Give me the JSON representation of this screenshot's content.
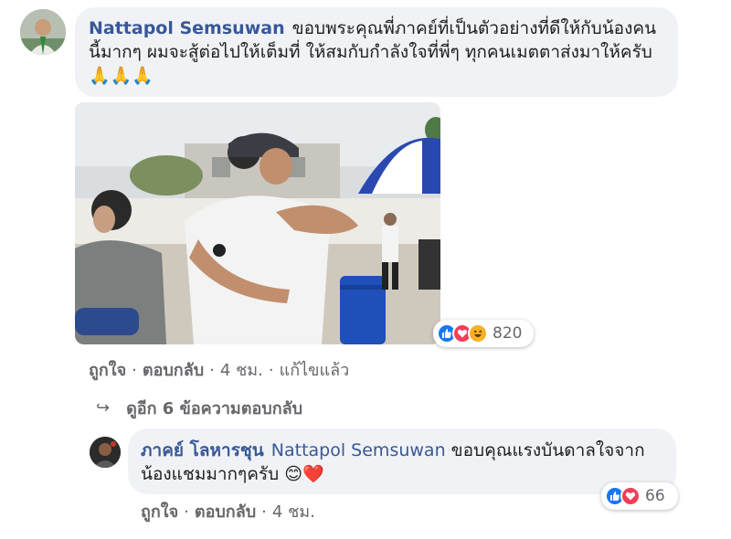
{
  "comment": {
    "author": "Nattapol Semsuwan",
    "text": "ขอบพระคุณพี่ภาคย์ที่เป็นตัวอย่างที่ดีให้กับน้องคนนี้มากๆ ผมจะสู้ต่อไปให้เต็มที่ ให้สมกับกำลังใจที่พี่ๆ ทุกคนเมตตาส่งมาให้ครับ",
    "emoji": "🙏🙏🙏",
    "reactions": {
      "icons": [
        "like-icon",
        "love-icon",
        "haha-icon"
      ],
      "count": "820"
    },
    "actions": {
      "like": "ถูกใจ",
      "reply": "ตอบกลับ",
      "time": "4 ชม.",
      "edited": "แก้ไขแล้ว"
    }
  },
  "more_replies": {
    "arrow": "↪",
    "label": "ดูอีก 6 ข้อความตอบกลับ"
  },
  "reply": {
    "author": "ภาคย์ โลหารชุน",
    "mention": "Nattapol Semsuwan",
    "text": "ขอบคุณแรงบันดาลใจจากน้องแชมมากๆครับ",
    "emoji": "😊❤️",
    "reactions": {
      "icons": [
        "like-icon",
        "love-icon"
      ],
      "count": "66"
    },
    "actions": {
      "like": "ถูกใจ",
      "reply": "ตอบกลับ",
      "time": "4 ชม."
    }
  },
  "colors": {
    "link": "#385898",
    "bubble": "#f0f2f5",
    "meta": "#65676b",
    "like": "#1877f2",
    "love": "#f33e58",
    "haha": "#f7b125"
  }
}
